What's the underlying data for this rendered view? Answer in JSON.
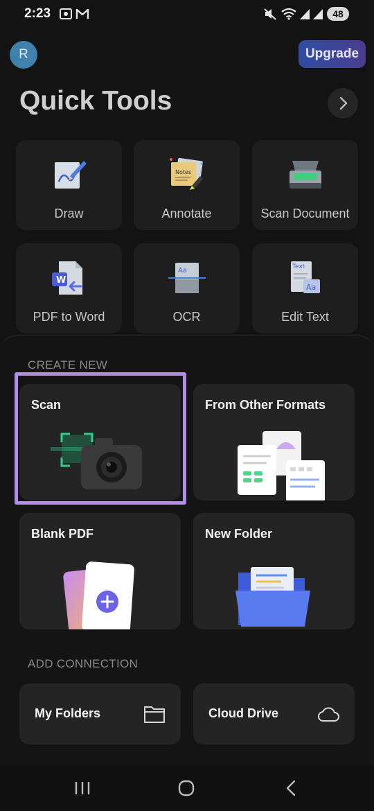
{
  "status_bar": {
    "time": "2:23",
    "battery": "48"
  },
  "header": {
    "avatar_initial": "R",
    "upgrade_label": "Upgrade",
    "title": "Quick Tools"
  },
  "quick_tools": [
    {
      "label": "Draw",
      "icon": "draw-icon"
    },
    {
      "label": "Annotate",
      "icon": "annotate-icon"
    },
    {
      "label": "Scan Document",
      "icon": "scanner-icon"
    },
    {
      "label": "PDF to Word",
      "icon": "pdf-to-word-icon"
    },
    {
      "label": "OCR",
      "icon": "ocr-icon"
    },
    {
      "label": "Edit Text",
      "icon": "edit-text-icon"
    }
  ],
  "annotate_note_text": "Notes",
  "ocr_icon_text": "Aa",
  "edit_text_icon_text": {
    "top": "Text",
    "bottom": "Aa"
  },
  "pdf_word_icon_text": "W",
  "create_new": {
    "label": "CREATE NEW",
    "items": [
      {
        "title": "Scan",
        "icon": "camera-scan-icon"
      },
      {
        "title": "From Other Formats",
        "icon": "documents-icon"
      },
      {
        "title": "Blank PDF",
        "icon": "blank-pdf-add-icon"
      },
      {
        "title": "New Folder",
        "icon": "folder-open-icon"
      }
    ]
  },
  "add_connection": {
    "label": "ADD CONNECTION",
    "items": [
      {
        "title": "My Folders",
        "icon": "folder-outline-icon"
      },
      {
        "title": "Cloud Drive",
        "icon": "cloud-icon"
      }
    ]
  },
  "colors": {
    "background": "#131313",
    "card": "#242424",
    "highlight": "#b38ee6",
    "upgrade_start": "#2f4da3",
    "upgrade_end": "#4a3d8f"
  }
}
